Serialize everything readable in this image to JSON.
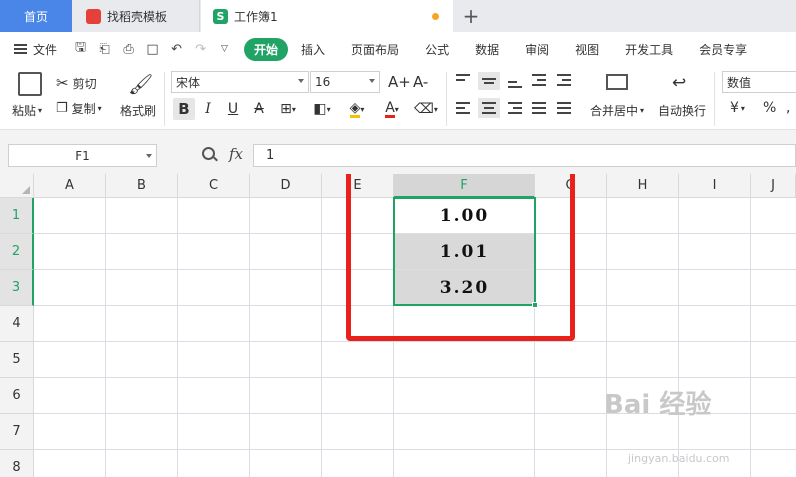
{
  "tabs": {
    "home": "首页",
    "template": "找稻壳模板",
    "workbook": "工作簿1",
    "add": "+"
  },
  "menu": {
    "file": "文件",
    "items": [
      "开始",
      "插入",
      "页面布局",
      "公式",
      "数据",
      "审阅",
      "视图",
      "开发工具",
      "会员专享"
    ],
    "active_index": 0
  },
  "ribbon": {
    "paste": "粘贴",
    "cut": "剪切",
    "copy": "复制",
    "format_painter": "格式刷",
    "font_name": "宋体",
    "font_size": "16",
    "bold": "B",
    "italic": "I",
    "underline": "U",
    "merge_center": "合并居中",
    "wrap_text": "自动换行",
    "number_format": "数值",
    "currency": "¥",
    "percent": "%",
    "font_color": "A",
    "grow_font": "A+",
    "shrink_font": "A-"
  },
  "formula_bar": {
    "name_box": "F1",
    "fx": "fx",
    "value": "1"
  },
  "sheet": {
    "columns": [
      "A",
      "B",
      "C",
      "D",
      "E",
      "F",
      "G",
      "H",
      "I",
      "J"
    ],
    "selected_column": "F",
    "rows": [
      "1",
      "2",
      "3",
      "4",
      "5",
      "6",
      "7",
      "8"
    ],
    "selected_rows": [
      "1",
      "2",
      "3"
    ],
    "cells": {
      "F1": "1.00",
      "F2": "1.01",
      "F3": "3.20"
    }
  },
  "colors": {
    "accent_green": "#21a366",
    "home_tab": "#4a86e8",
    "highlight_box": "#e8211b",
    "cell_fill": "#d9d9d9"
  },
  "watermark": {
    "main": "Bai 经验",
    "sub": "jingyan.baidu.com"
  }
}
